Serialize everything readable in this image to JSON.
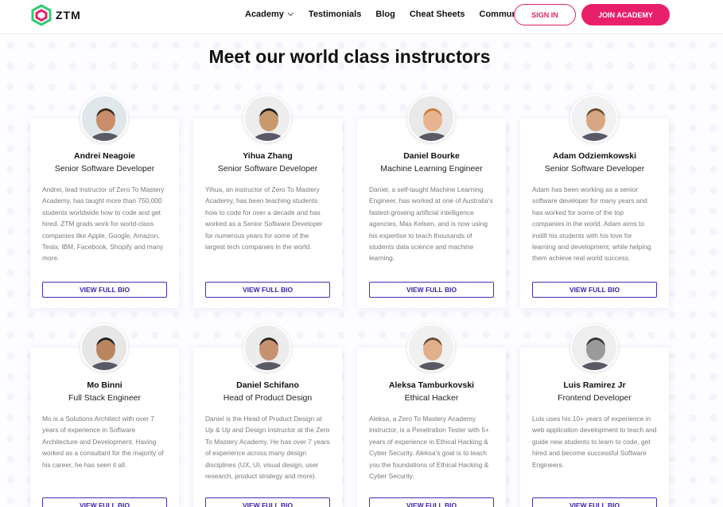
{
  "header": {
    "logo_text": "ZTM",
    "nav": [
      {
        "label": "Academy",
        "has_dropdown": true
      },
      {
        "label": "Testimonials"
      },
      {
        "label": "Blog"
      },
      {
        "label": "Cheat Sheets"
      },
      {
        "label": "Community"
      }
    ],
    "sign_in": "SIGN IN",
    "join": "JOIN ACADEMY"
  },
  "colors": {
    "accent": "#e81f6b",
    "button_border": "#4a2bb5",
    "logo_green": "#2ecc71",
    "logo_pink": "#e81f6b"
  },
  "title": "Meet our world class instructors",
  "instructors": [
    {
      "name": "Andrei Neagoie",
      "role": "Senior Software Developer",
      "bio": "Andrei, lead instructor of Zero To Mastery Academy, has taught more than 750,000 students worldwide how to code and get hired. ZTM grads work for world-class companies like Apple, Google, Amazon, Tesla, IBM, Facebook, Shopify and many more.",
      "button": "VIEW FULL BIO"
    },
    {
      "name": "Yihua Zhang",
      "role": "Senior Software Developer",
      "bio": "Yihua, an instructor of Zero To Mastery Academy, has been teaching students how to code for over a decade and has worked as a Senior Software Developer for numerous years for some of the largest tech companies in the world.",
      "button": "VIEW FULL BIO"
    },
    {
      "name": "Daniel Bourke",
      "role": "Machine Learning Engineer",
      "bio": "Daniel, a self-taught Machine Learning Engineer, has worked at one of Australia's fastest-growing artificial intelligence agencies, Max Kelsen, and is now using his expertise to teach thousands of students data science and machine learning.",
      "button": "VIEW FULL BIO"
    },
    {
      "name": "Adam Odziemkowski",
      "role": "Senior Software Developer",
      "bio": "Adam has been working as a senior software developer for many years and has worked for some of the top companies in the world. Adam aims to instill his students with his love for learning and development, while helping them achieve real world success.",
      "button": "VIEW FULL BIO"
    },
    {
      "name": "Mo Binni",
      "role": "Full Stack Engineer",
      "bio": "Mo is a Solutions Architect with over 7 years of experience in Software Architecture and Development. Having worked as a consultant for the majority of his career, he has seen it all.",
      "button": "VIEW FULL BIO"
    },
    {
      "name": "Daniel Schifano",
      "role": "Head of Product Design",
      "bio": "Daniel is the Head of Product Design at Up & Up and Design Instructor at the Zero To Mastery Academy. He has over 7 years of experience across many design disciplines (UX, UI, visual design, user research, product strategy and more).",
      "button": "VIEW FULL BIO"
    },
    {
      "name": "Aleksa Tamburkovski",
      "role": "Ethical Hacker",
      "bio": "Aleksa, a Zero To Mastery Academy instructor, is a Penetration Tester with 5+ years of experience in Ethical Hacking & Cyber Security. Aleksa's goal is to teach you the foundations of Ethical Hacking & Cyber Security.",
      "button": "VIEW FULL BIO"
    },
    {
      "name": "Luis Ramirez Jr",
      "role": "Frontend Developer",
      "bio": "Luis uses his 10+ years of experience in web application development to teach and guide new students to learn to code, get hired and become successful Software Engineers.",
      "button": "VIEW FULL BIO"
    }
  ]
}
